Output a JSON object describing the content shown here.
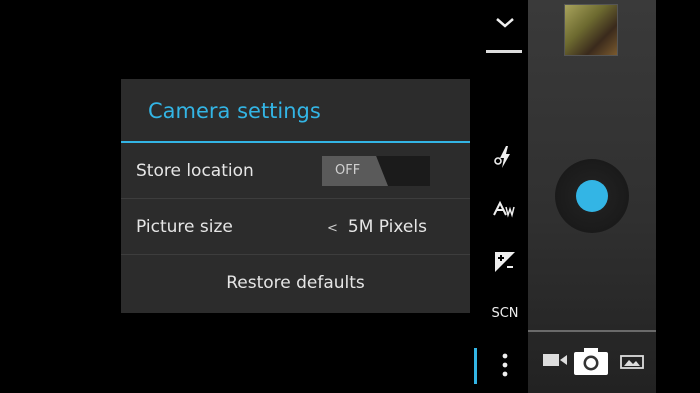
{
  "dialog": {
    "title": "Camera settings",
    "store_location": {
      "label": "Store location",
      "toggle_text": "OFF"
    },
    "picture_size": {
      "label": "Picture size",
      "value": "5M Pixels",
      "arrow": "<"
    },
    "restore_label": "Restore defaults"
  },
  "menu": {
    "items": [
      {
        "name": "collapse",
        "icon": "chevron-down-icon"
      },
      {
        "name": "flash",
        "icon": "flash-auto-icon"
      },
      {
        "name": "white-balance",
        "icon": "white-balance-auto-icon"
      },
      {
        "name": "exposure",
        "icon": "exposure-icon"
      },
      {
        "name": "scene",
        "label": "SCN"
      },
      {
        "name": "more",
        "icon": "more-vert-icon"
      }
    ]
  },
  "controls": {
    "modes": [
      "video-mode-icon",
      "camera-mode-icon",
      "panorama-mode-icon"
    ]
  },
  "colors": {
    "accent": "#33b5e5",
    "dialog_bg": "#2c2c2c",
    "panel_bg": "#333333"
  }
}
